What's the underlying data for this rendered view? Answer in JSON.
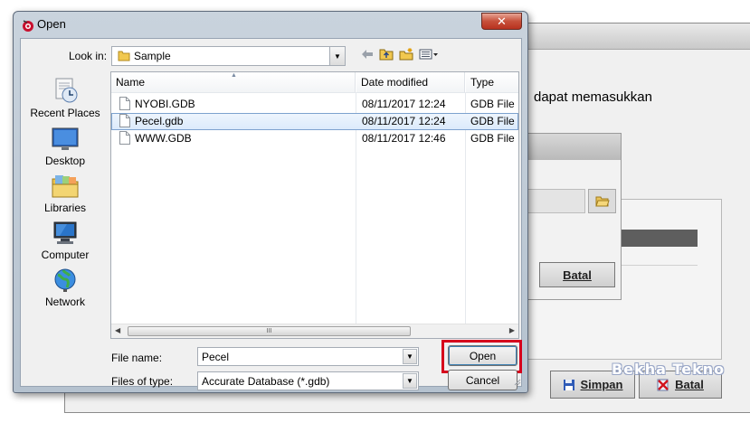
{
  "background_window": {
    "text_fragment": "dapat memasukkan",
    "batal_small_label": "Batal",
    "simpan_label": "Simpan",
    "batal_label": "Batal",
    "watermark": "Bekha Tekno"
  },
  "dialog": {
    "title": "Open",
    "close_glyph": "✕",
    "look_in": {
      "label": "Look in:",
      "value": "Sample"
    },
    "places": [
      {
        "label": "Recent Places",
        "icon": "recent-places-icon"
      },
      {
        "label": "Desktop",
        "icon": "desktop-icon"
      },
      {
        "label": "Libraries",
        "icon": "libraries-icon"
      },
      {
        "label": "Computer",
        "icon": "computer-icon"
      },
      {
        "label": "Network",
        "icon": "network-icon"
      }
    ],
    "columns": {
      "name": "Name",
      "date_modified": "Date modified",
      "type": "Type"
    },
    "files": [
      {
        "name": "NYOBI.GDB",
        "date": "08/11/2017 12:24",
        "type": "GDB File"
      },
      {
        "name": "Pecel.gdb",
        "date": "08/11/2017 12:24",
        "type": "GDB File",
        "selected": true
      },
      {
        "name": "WWW.GDB",
        "date": "08/11/2017 12:46",
        "type": "GDB File"
      }
    ],
    "scroll_grip": "III",
    "file_name": {
      "label": "File name:",
      "value": "Pecel"
    },
    "files_of_type": {
      "label": "Files of type:",
      "value": "Accurate Database (*.gdb)"
    },
    "open_label": "Open",
    "cancel_label": "Cancel"
  },
  "colors": {
    "highlight_frame": "#d6001c",
    "selected_row": "#dbeafb",
    "close_button": "#c7503a"
  }
}
